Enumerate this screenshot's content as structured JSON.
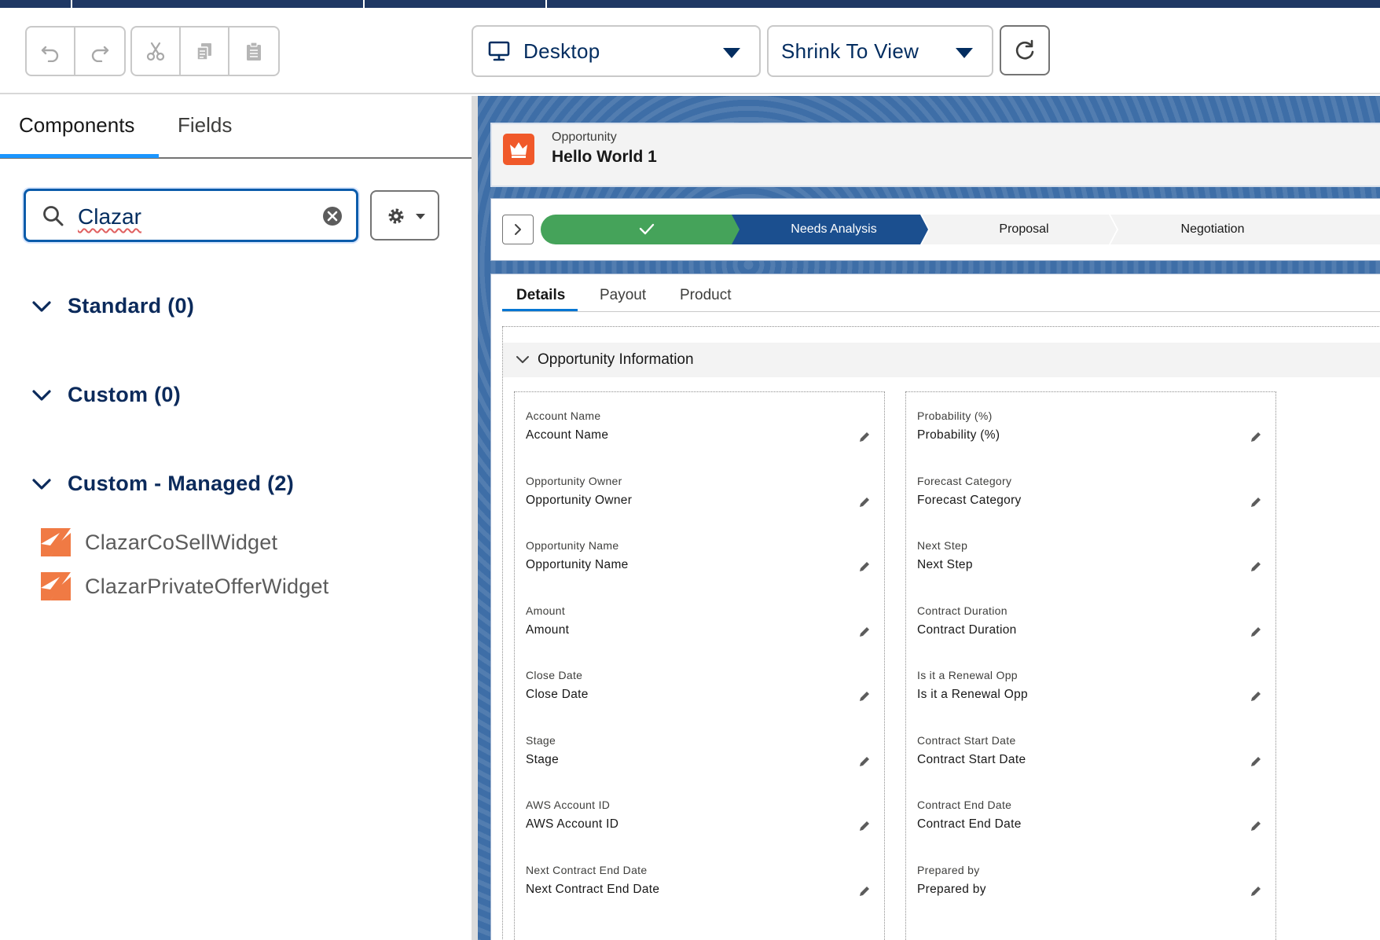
{
  "toolbar": {
    "undo_icon": "undo-icon",
    "redo_icon": "redo-icon",
    "cut_icon": "cut-icon",
    "copy_icon": "copy-icon",
    "paste_icon": "paste-icon",
    "device_select": {
      "icon": "desktop-icon",
      "value": "Desktop"
    },
    "zoom_select": {
      "value": "Shrink To View"
    },
    "refresh_icon": "refresh-icon"
  },
  "left_panel": {
    "tabs": [
      {
        "label": "Components",
        "active": true
      },
      {
        "label": "Fields",
        "active": false
      }
    ],
    "search": {
      "value": "Clazar"
    },
    "sections": [
      {
        "label": "Standard (0)"
      },
      {
        "label": "Custom (0)"
      },
      {
        "label": "Custom - Managed (2)"
      }
    ],
    "components": [
      {
        "label": "ClazarCoSellWidget"
      },
      {
        "label": "ClazarPrivateOfferWidget"
      }
    ]
  },
  "record": {
    "object_type": "Opportunity",
    "name": "Hello World 1"
  },
  "path": {
    "stages": [
      {
        "label": "",
        "status": "complete"
      },
      {
        "label": "Needs Analysis",
        "status": "current"
      },
      {
        "label": "Proposal",
        "status": "upcoming"
      },
      {
        "label": "Negotiation",
        "status": "upcoming"
      }
    ]
  },
  "details": {
    "tabs": [
      {
        "label": "Details",
        "active": true
      },
      {
        "label": "Payout",
        "active": false
      },
      {
        "label": "Product",
        "active": false
      }
    ],
    "section_title": "Opportunity Information",
    "left_fields": [
      {
        "label": "Account Name",
        "value": "Account Name"
      },
      {
        "label": "Opportunity Owner",
        "value": "Opportunity Owner"
      },
      {
        "label": "Opportunity Name",
        "value": "Opportunity Name"
      },
      {
        "label": "Amount",
        "value": "Amount"
      },
      {
        "label": "Close Date",
        "value": "Close Date"
      },
      {
        "label": "Stage",
        "value": "Stage"
      },
      {
        "label": "AWS Account ID",
        "value": "AWS Account ID"
      },
      {
        "label": "Next Contract End Date",
        "value": "Next Contract End Date"
      }
    ],
    "right_fields": [
      {
        "label": "Probability (%)",
        "value": "Probability (%)"
      },
      {
        "label": "Forecast Category",
        "value": "Forecast Category"
      },
      {
        "label": "Next Step",
        "value": "Next Step"
      },
      {
        "label": "Contract Duration",
        "value": "Contract Duration"
      },
      {
        "label": "Is it a Renewal Opp",
        "value": "Is it a Renewal Opp"
      },
      {
        "label": "Contract Start Date",
        "value": "Contract Start Date"
      },
      {
        "label": "Contract End Date",
        "value": "Contract End Date"
      },
      {
        "label": "Prepared by",
        "value": "Prepared by"
      }
    ]
  },
  "colors": {
    "brand_navy": "#032d60",
    "active_tab": "#1b96ff",
    "path_complete": "#45a35a",
    "path_current": "#1b4f8f",
    "record_icon": "#f0592a",
    "clazar_icon": "#f07a44"
  }
}
